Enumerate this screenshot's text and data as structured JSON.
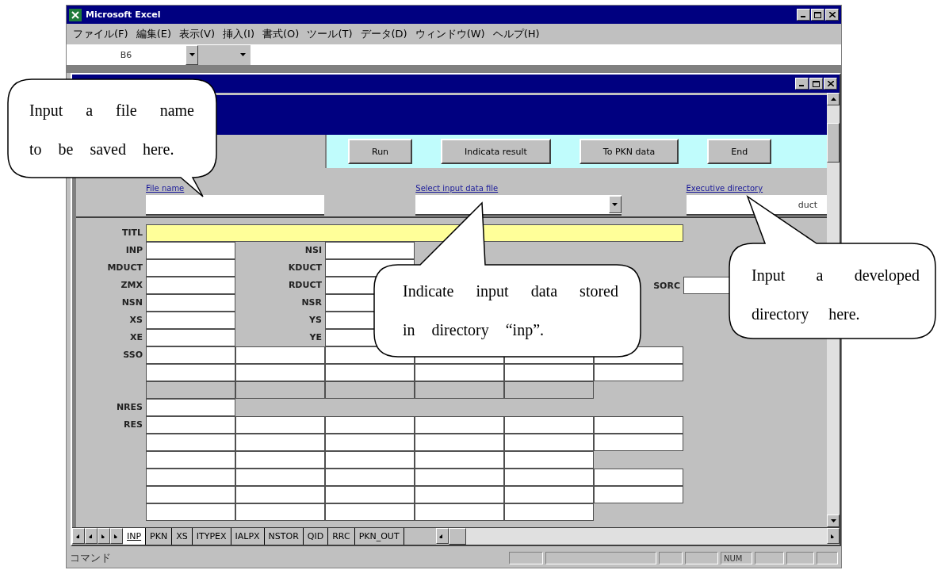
{
  "app": {
    "title": "Microsoft Excel"
  },
  "menu": [
    "ファイル(F)",
    "編集(E)",
    "表示(V)",
    "挿入(I)",
    "書式(O)",
    "ツール(T)",
    "データ(D)",
    "ウィンドウ(W)",
    "ヘルプ(H)"
  ],
  "formula_bar": {
    "name_box": "B6"
  },
  "sheet": {
    "buttons": [
      "Run",
      "Indicata result",
      "To PKN data",
      "End"
    ],
    "fields": [
      {
        "kind": "text",
        "label": "File name"
      },
      {
        "kind": "dropdown",
        "label": "Select input data file"
      },
      {
        "kind": "text",
        "label": "Executive directory",
        "value": "duct"
      }
    ],
    "rows": [
      {
        "kind": "title",
        "label": "TITL"
      },
      {
        "kind": "pair",
        "label": "INP",
        "inner_label": "NSI"
      },
      {
        "kind": "pair",
        "label": "MDUCT",
        "inner_label": "KDUCT"
      },
      {
        "kind": "pair",
        "label": "ZMX",
        "inner_label": "RDUCT",
        "side_label": "SORC"
      },
      {
        "kind": "pair",
        "label": "NSN",
        "inner_label": "NSR"
      },
      {
        "kind": "pair",
        "label": "XS",
        "inner_label": "YS"
      },
      {
        "kind": "pair",
        "label": "XE",
        "inner_label": "YE"
      },
      {
        "kind": "six",
        "label": "SSO"
      },
      {
        "kind": "six"
      },
      {
        "kind": "lines"
      },
      {
        "kind": "single",
        "label": "NRES"
      },
      {
        "kind": "six",
        "label": "RES"
      },
      {
        "kind": "six"
      },
      {
        "kind": "five"
      },
      {
        "kind": "six"
      },
      {
        "kind": "six"
      },
      {
        "kind": "five"
      }
    ]
  },
  "sheet_tabs": [
    {
      "label": "INP",
      "selected": true
    },
    {
      "label": "PKN",
      "selected": false
    },
    {
      "label": "XS",
      "selected": false
    },
    {
      "label": "ITYPEX",
      "selected": false
    },
    {
      "label": "IALPX",
      "selected": false
    },
    {
      "label": "NSTOR",
      "selected": false
    },
    {
      "label": "QID",
      "selected": false
    },
    {
      "label": "RRC",
      "selected": false
    },
    {
      "label": "PKN_OUT",
      "selected": false
    }
  ],
  "status_bar": {
    "mode": "コマンド",
    "indicator": "NUM"
  },
  "callouts": [
    {
      "text": "Input a file name to be saved here."
    },
    {
      "text": "Indicate input data stored in directory “inp”."
    },
    {
      "text": "Input a developed directory here."
    }
  ]
}
